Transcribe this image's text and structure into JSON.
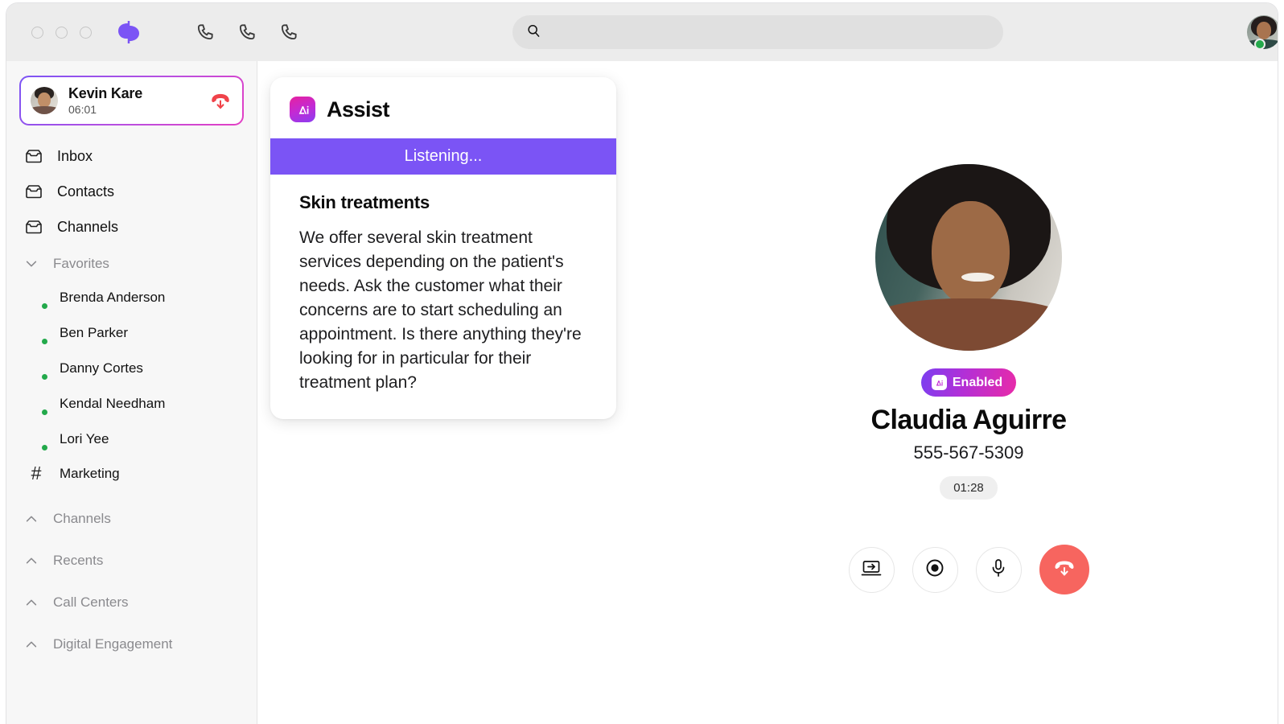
{
  "titlebar": {
    "window_controls": [
      "close",
      "minimize",
      "maximize"
    ],
    "logo_icon": "app-logo-icon",
    "phone_icons": [
      "phone-icon-1",
      "phone-icon-2",
      "phone-icon-3"
    ],
    "search": {
      "value": "",
      "placeholder": "",
      "icon": "search-icon"
    },
    "user_avatar": {
      "icon": "avatar",
      "status": "online"
    }
  },
  "sidebar": {
    "active_call": {
      "name": "Kevin Kare",
      "duration": "06:01",
      "hangup_icon": "hangup-down-icon"
    },
    "nav": [
      {
        "label": "Inbox",
        "icon": "inbox-icon"
      },
      {
        "label": "Contacts",
        "icon": "inbox-icon"
      },
      {
        "label": "Channels",
        "icon": "inbox-icon"
      }
    ],
    "favorites": {
      "label": "Favorites",
      "expanded": true,
      "chevron": "chevron-down-icon",
      "contacts": [
        {
          "name": "Brenda Anderson",
          "status": "online"
        },
        {
          "name": "Ben Parker",
          "status": "online"
        },
        {
          "name": "Danny Cortes",
          "status": "online"
        },
        {
          "name": "Kendal Needham",
          "status": "online"
        },
        {
          "name": "Lori Yee",
          "status": "online"
        }
      ],
      "channel": {
        "name": "Marketing",
        "icon": "hash-icon"
      }
    },
    "sections": [
      {
        "label": "Channels",
        "chevron": "chevron-up-icon"
      },
      {
        "label": "Recents",
        "chevron": "chevron-up-icon"
      },
      {
        "label": "Call Centers",
        "chevron": "chevron-up-icon"
      },
      {
        "label": "Digital Engagement",
        "chevron": "chevron-up-icon"
      }
    ]
  },
  "assist": {
    "title": "Assist",
    "logo_icon": "ai-logo-icon",
    "status_banner": "Listening...",
    "heading": "Skin treatments",
    "body": "We offer several skin treatment services depending on the patient's needs. Ask the customer what their concerns are to start scheduling an appointment. Is there anything they're looking for in particular for their treatment plan?"
  },
  "call": {
    "avatar_icon": "caller-avatar",
    "ai_badge": {
      "label": "Enabled",
      "icon": "ai-logo-icon"
    },
    "name": "Claudia Aguirre",
    "phone": "555-567-5309",
    "timer": "01:28",
    "controls": [
      {
        "name": "screen-share",
        "icon": "screen-share-icon"
      },
      {
        "name": "record",
        "icon": "record-icon"
      },
      {
        "name": "mute",
        "icon": "microphone-icon"
      },
      {
        "name": "end-call",
        "icon": "hangup-down-icon"
      }
    ]
  },
  "colors": {
    "accent_purple": "#7b54f5",
    "accent_magenta": "#e82ba8",
    "status_green": "#23a94b",
    "end_call_red": "#f7655f",
    "titlebar_bg": "#ececec",
    "sidebar_bg": "#f7f7f7"
  }
}
